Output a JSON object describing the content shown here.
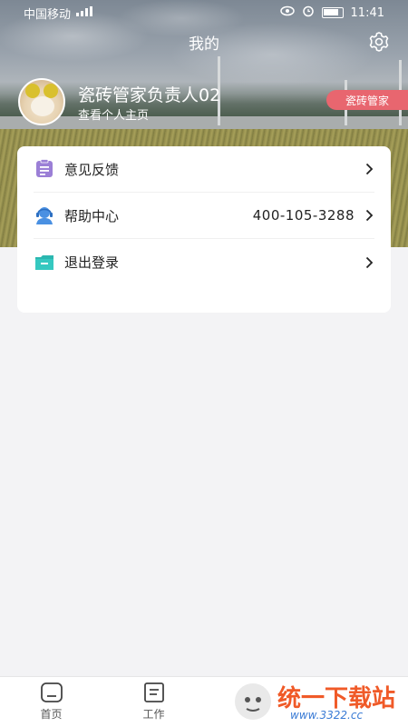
{
  "status_bar": {
    "carrier": "中国移动",
    "time": "11:41"
  },
  "header": {
    "title": "我的"
  },
  "profile": {
    "name": "瓷砖管家负责人02",
    "subtitle": "查看个人主页",
    "role_badge": "瓷砖管家"
  },
  "menu": {
    "items": [
      {
        "label": "意见反馈",
        "icon": "feedback-icon",
        "value": ""
      },
      {
        "label": "帮助中心",
        "icon": "support-icon",
        "value": "400-105-3288"
      },
      {
        "label": "退出登录",
        "icon": "logout-icon",
        "value": ""
      }
    ]
  },
  "tabs": [
    {
      "label": "首页",
      "icon": "home-icon"
    },
    {
      "label": "工作",
      "icon": "work-icon"
    }
  ],
  "watermark": {
    "text": "统一下载站",
    "url": "www.3322.cc"
  },
  "colors": {
    "badge": "#e8666f",
    "feedback_icon": "#9b7fd6",
    "support_icon": "#4a90e2",
    "logout_icon": "#2bb7b0"
  }
}
